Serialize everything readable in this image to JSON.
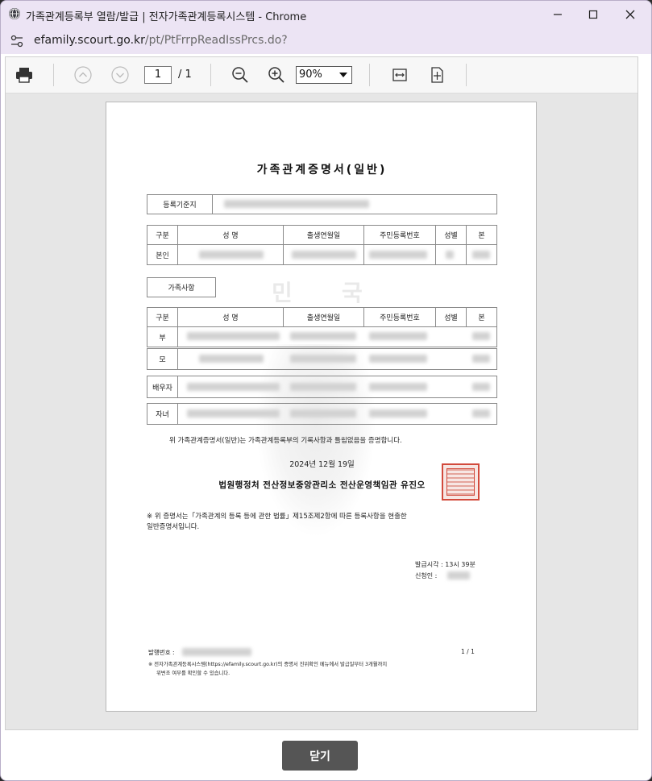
{
  "window": {
    "title": "가족관계등록부 열람/발급 | 전자가족관계등록시스템 - Chrome",
    "url_host": "efamily.scourt.go.kr",
    "url_path": "/pt/PtFrrpReadIssPrcs.do?"
  },
  "viewer": {
    "page_current": "1",
    "page_total": "/ 1",
    "zoom": "90%"
  },
  "document": {
    "title": "가족관계증명서(일반)",
    "reg_base_label": "등록기준지",
    "headers": {
      "category": "구분",
      "name": "성   명",
      "birth": "출생연월일",
      "rrn": "주민등록번호",
      "sex": "성별",
      "origin": "본"
    },
    "self_label": "본인",
    "family_section_label": "가족사항",
    "family_rows": [
      "부",
      "모",
      "배우자",
      "자녀"
    ],
    "watermark_chars": [
      "민",
      "국"
    ],
    "certify_text": "위 가족관계증명서(일반)는 가족관계등록부의 기록사항과 틀림없음을 증명합니다.",
    "date": "2024년 12월 19일",
    "issuer": "법원행정처 전산정보중앙관리소 전산운영책임관 유진오",
    "notice": "※ 위 증명서는「가족관계의 등록 등에 관한 법률」제15조제2항에 따른 등록사항을 현출한",
    "notice2": "일반증명서입니다.",
    "issue_time": "발급시각 : 13시 39분",
    "applicant": "신청인 :",
    "issue_no": "발행번호 :",
    "page_no": "1 / 1",
    "footer1": "※ 전자가족관계등록시스템(https://efamily.scourt.go.kr)의 증명서 진위확인 메뉴에서 발급일부터 3개월까지",
    "footer2": "위변조 여부를 확인할 수 있습니다."
  },
  "buttons": {
    "close": "닫기"
  },
  "colors": {
    "titlebar": "#ece4f4",
    "close_button": "#555555",
    "seal": "#d24a3c"
  }
}
